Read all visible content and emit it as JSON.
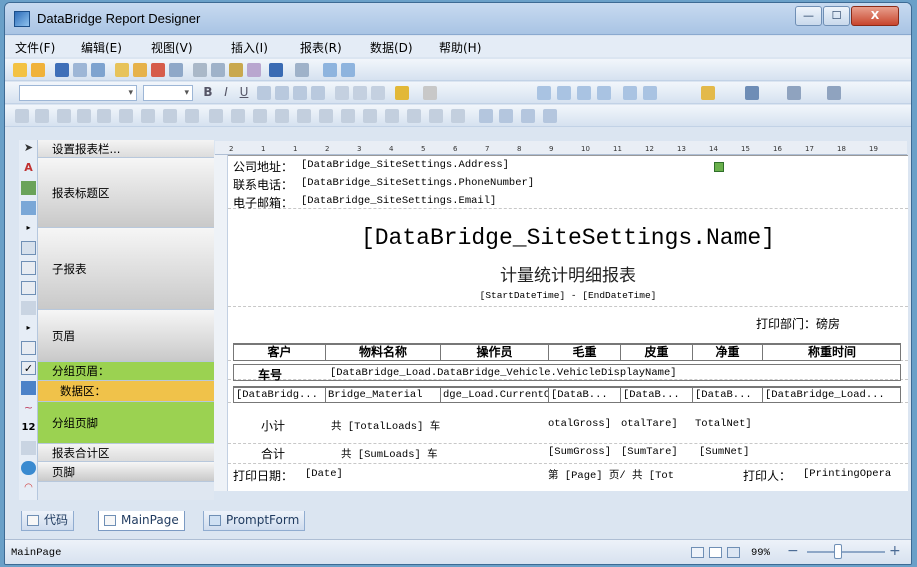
{
  "app": {
    "title": "DataBridge Report Designer"
  },
  "window_controls": {
    "minimize": "—",
    "maximize": "☐",
    "close": "X"
  },
  "menu": [
    "文件(F)",
    "编辑(E)",
    "视图(V)",
    "插入(I)",
    "报表(R)",
    "数据(D)",
    "帮助(H)"
  ],
  "format_toolbar": {
    "bold": "B",
    "italic": "I",
    "underline": "U"
  },
  "band_header": "设置报表栏...",
  "bands": [
    "报表标题区",
    "子报表",
    "页眉",
    "分组页眉：",
    "数据区：",
    "分组页脚",
    "报表合计区",
    "页脚"
  ],
  "ruler_numbers": [
    "2",
    "1",
    "1",
    "2",
    "3",
    "4",
    "5",
    "6",
    "7",
    "8",
    "9",
    "10",
    "11",
    "12",
    "13",
    "14",
    "15",
    "16",
    "17",
    "18",
    "19"
  ],
  "report": {
    "address_label": "公司地址：",
    "address_field": "[DataBridge_SiteSettings.Address]",
    "phone_label": "联系电话：",
    "phone_field": "[DataBridge_SiteSettings.PhoneNumber]",
    "email_label": "电子邮箱：",
    "email_field": "[DataBridge_SiteSettings.Email]",
    "site_name": "[DataBridge_SiteSettings.Name]",
    "subtitle": "计量统计明细报表",
    "date_range": "[StartDateTime] - [EndDateTime]",
    "print_dept": "打印部门：磅房",
    "headers": [
      "客户",
      "物料名称",
      "操作员",
      "毛重",
      "皮重",
      "净重",
      "称重时间"
    ],
    "group_header": {
      "plate_label": "车号",
      "plate_field": "[DataBridge_Load.DataBridge_Vehicle.VehicleDisplayName]"
    },
    "data_row": [
      "[DataBridg...",
      "Bridge_Material",
      "dge_Load.CurrentO",
      "[DataB...",
      "[DataB...",
      "[DataB...",
      "[DataBridge_Load..."
    ],
    "subtotal": {
      "label": "小计",
      "count": "共 [TotalLoads] 车",
      "gross": "otalGross]",
      "tare": "otalTare]",
      "net": "TotalNet]"
    },
    "total": {
      "label": "合计",
      "count": "共 [SumLoads] 车",
      "gross": "[SumGross]",
      "tare": "[SumTare]",
      "net": "[SumNet]"
    },
    "footer": {
      "print_date_label": "打印日期：",
      "print_date_field": "[Date]",
      "page_info": "第 [Page] 页/ 共 [Tot",
      "printer": "打印人：",
      "printer_field": "[PrintingOpera"
    }
  },
  "tabs": [
    "代码",
    "MainPage",
    "PromptForm"
  ],
  "status": {
    "page": "MainPage",
    "zoom": "99%",
    "zoom_minus": "−",
    "zoom_plus": "+"
  }
}
